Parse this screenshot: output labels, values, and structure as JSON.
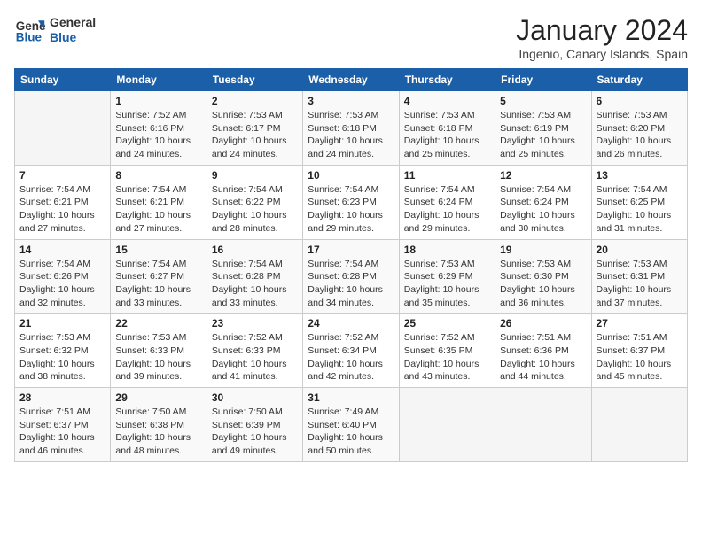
{
  "header": {
    "logo_line1": "General",
    "logo_line2": "Blue",
    "month_title": "January 2024",
    "location": "Ingenio, Canary Islands, Spain"
  },
  "weekdays": [
    "Sunday",
    "Monday",
    "Tuesday",
    "Wednesday",
    "Thursday",
    "Friday",
    "Saturday"
  ],
  "weeks": [
    [
      {
        "num": "",
        "info": ""
      },
      {
        "num": "1",
        "info": "Sunrise: 7:52 AM\nSunset: 6:16 PM\nDaylight: 10 hours\nand 24 minutes."
      },
      {
        "num": "2",
        "info": "Sunrise: 7:53 AM\nSunset: 6:17 PM\nDaylight: 10 hours\nand 24 minutes."
      },
      {
        "num": "3",
        "info": "Sunrise: 7:53 AM\nSunset: 6:18 PM\nDaylight: 10 hours\nand 24 minutes."
      },
      {
        "num": "4",
        "info": "Sunrise: 7:53 AM\nSunset: 6:18 PM\nDaylight: 10 hours\nand 25 minutes."
      },
      {
        "num": "5",
        "info": "Sunrise: 7:53 AM\nSunset: 6:19 PM\nDaylight: 10 hours\nand 25 minutes."
      },
      {
        "num": "6",
        "info": "Sunrise: 7:53 AM\nSunset: 6:20 PM\nDaylight: 10 hours\nand 26 minutes."
      }
    ],
    [
      {
        "num": "7",
        "info": "Sunrise: 7:54 AM\nSunset: 6:21 PM\nDaylight: 10 hours\nand 27 minutes."
      },
      {
        "num": "8",
        "info": "Sunrise: 7:54 AM\nSunset: 6:21 PM\nDaylight: 10 hours\nand 27 minutes."
      },
      {
        "num": "9",
        "info": "Sunrise: 7:54 AM\nSunset: 6:22 PM\nDaylight: 10 hours\nand 28 minutes."
      },
      {
        "num": "10",
        "info": "Sunrise: 7:54 AM\nSunset: 6:23 PM\nDaylight: 10 hours\nand 29 minutes."
      },
      {
        "num": "11",
        "info": "Sunrise: 7:54 AM\nSunset: 6:24 PM\nDaylight: 10 hours\nand 29 minutes."
      },
      {
        "num": "12",
        "info": "Sunrise: 7:54 AM\nSunset: 6:24 PM\nDaylight: 10 hours\nand 30 minutes."
      },
      {
        "num": "13",
        "info": "Sunrise: 7:54 AM\nSunset: 6:25 PM\nDaylight: 10 hours\nand 31 minutes."
      }
    ],
    [
      {
        "num": "14",
        "info": "Sunrise: 7:54 AM\nSunset: 6:26 PM\nDaylight: 10 hours\nand 32 minutes."
      },
      {
        "num": "15",
        "info": "Sunrise: 7:54 AM\nSunset: 6:27 PM\nDaylight: 10 hours\nand 33 minutes."
      },
      {
        "num": "16",
        "info": "Sunrise: 7:54 AM\nSunset: 6:28 PM\nDaylight: 10 hours\nand 33 minutes."
      },
      {
        "num": "17",
        "info": "Sunrise: 7:54 AM\nSunset: 6:28 PM\nDaylight: 10 hours\nand 34 minutes."
      },
      {
        "num": "18",
        "info": "Sunrise: 7:53 AM\nSunset: 6:29 PM\nDaylight: 10 hours\nand 35 minutes."
      },
      {
        "num": "19",
        "info": "Sunrise: 7:53 AM\nSunset: 6:30 PM\nDaylight: 10 hours\nand 36 minutes."
      },
      {
        "num": "20",
        "info": "Sunrise: 7:53 AM\nSunset: 6:31 PM\nDaylight: 10 hours\nand 37 minutes."
      }
    ],
    [
      {
        "num": "21",
        "info": "Sunrise: 7:53 AM\nSunset: 6:32 PM\nDaylight: 10 hours\nand 38 minutes."
      },
      {
        "num": "22",
        "info": "Sunrise: 7:53 AM\nSunset: 6:33 PM\nDaylight: 10 hours\nand 39 minutes."
      },
      {
        "num": "23",
        "info": "Sunrise: 7:52 AM\nSunset: 6:33 PM\nDaylight: 10 hours\nand 41 minutes."
      },
      {
        "num": "24",
        "info": "Sunrise: 7:52 AM\nSunset: 6:34 PM\nDaylight: 10 hours\nand 42 minutes."
      },
      {
        "num": "25",
        "info": "Sunrise: 7:52 AM\nSunset: 6:35 PM\nDaylight: 10 hours\nand 43 minutes."
      },
      {
        "num": "26",
        "info": "Sunrise: 7:51 AM\nSunset: 6:36 PM\nDaylight: 10 hours\nand 44 minutes."
      },
      {
        "num": "27",
        "info": "Sunrise: 7:51 AM\nSunset: 6:37 PM\nDaylight: 10 hours\nand 45 minutes."
      }
    ],
    [
      {
        "num": "28",
        "info": "Sunrise: 7:51 AM\nSunset: 6:37 PM\nDaylight: 10 hours\nand 46 minutes."
      },
      {
        "num": "29",
        "info": "Sunrise: 7:50 AM\nSunset: 6:38 PM\nDaylight: 10 hours\nand 48 minutes."
      },
      {
        "num": "30",
        "info": "Sunrise: 7:50 AM\nSunset: 6:39 PM\nDaylight: 10 hours\nand 49 minutes."
      },
      {
        "num": "31",
        "info": "Sunrise: 7:49 AM\nSunset: 6:40 PM\nDaylight: 10 hours\nand 50 minutes."
      },
      {
        "num": "",
        "info": ""
      },
      {
        "num": "",
        "info": ""
      },
      {
        "num": "",
        "info": ""
      }
    ]
  ]
}
